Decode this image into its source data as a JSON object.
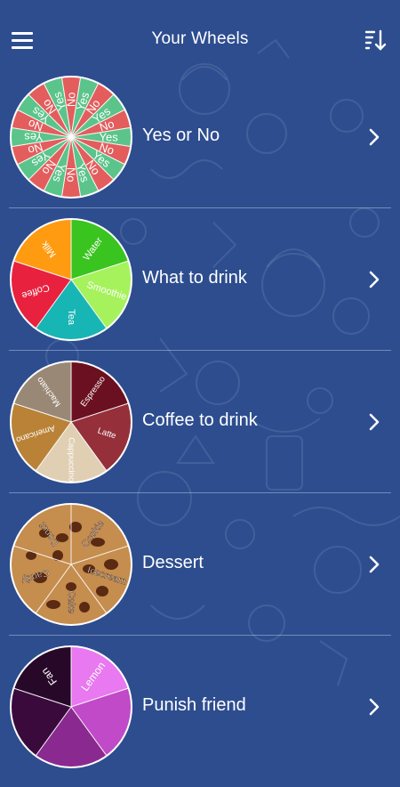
{
  "header": {
    "title": "Your Wheels",
    "menu_icon": "hamburger-menu-icon",
    "sort_icon": "sort-descending-icon"
  },
  "colors": {
    "background": "#2d4d8f",
    "text": "#ffffff"
  },
  "wheels": [
    {
      "label": "Yes or No",
      "segments": [
        {
          "text": "No",
          "color": "#e35d5d"
        },
        {
          "text": "Yes",
          "color": "#5bc48a"
        },
        {
          "text": "No",
          "color": "#e35d5d"
        },
        {
          "text": "Yes",
          "color": "#5bc48a"
        },
        {
          "text": "No",
          "color": "#e35d5d"
        },
        {
          "text": "Yes",
          "color": "#5bc48a"
        },
        {
          "text": "No",
          "color": "#e35d5d"
        },
        {
          "text": "Yes",
          "color": "#5bc48a"
        },
        {
          "text": "No",
          "color": "#e35d5d"
        },
        {
          "text": "Yes",
          "color": "#5bc48a"
        },
        {
          "text": "No",
          "color": "#e35d5d"
        },
        {
          "text": "Yes",
          "color": "#5bc48a"
        },
        {
          "text": "No",
          "color": "#e35d5d"
        },
        {
          "text": "Yes",
          "color": "#5bc48a"
        },
        {
          "text": "No",
          "color": "#e35d5d"
        },
        {
          "text": "Yes",
          "color": "#5bc48a"
        },
        {
          "text": "No",
          "color": "#e35d5d"
        },
        {
          "text": "Yes",
          "color": "#5bc48a"
        },
        {
          "text": "No",
          "color": "#e35d5d"
        },
        {
          "text": "Yes",
          "color": "#5bc48a"
        }
      ]
    },
    {
      "label": "What to drink",
      "segments": [
        {
          "text": "Water",
          "color": "#39c41f"
        },
        {
          "text": "Smoothie",
          "color": "#a6f25d"
        },
        {
          "text": "Tea",
          "color": "#17b5b3"
        },
        {
          "text": "Coffee",
          "color": "#e8213f"
        },
        {
          "text": "Milk",
          "color": "#ff9b10"
        }
      ]
    },
    {
      "label": "Coffee to drink",
      "segments": [
        {
          "text": "Espresso",
          "color": "#6b1020"
        },
        {
          "text": "Latte",
          "color": "#95303a"
        },
        {
          "text": "Cappuccino",
          "color": "#e0cfb3"
        },
        {
          "text": "Americano",
          "color": "#b98236"
        },
        {
          "text": "Machiato",
          "color": "#9a8876"
        }
      ]
    },
    {
      "label": "Dessert",
      "segments": [
        {
          "text": "Cookie",
          "color": "#c08a4a"
        },
        {
          "text": "Icecream",
          "color": "#c08a4a"
        },
        {
          "text": "Cake",
          "color": "#c08a4a"
        },
        {
          "text": "Candy",
          "color": "#c08a4a"
        },
        {
          "text": "Donut",
          "color": "#c08a4a"
        }
      ]
    },
    {
      "label": "Punish friend",
      "segments": [
        {
          "text": "Lemon",
          "color": "#e879f0"
        },
        {
          "text": "",
          "color": "#c04ac8"
        },
        {
          "text": "",
          "color": "#8a2a90"
        },
        {
          "text": "",
          "color": "#3b0a3c"
        },
        {
          "text": "Fan",
          "color": "#280828"
        }
      ]
    }
  ]
}
